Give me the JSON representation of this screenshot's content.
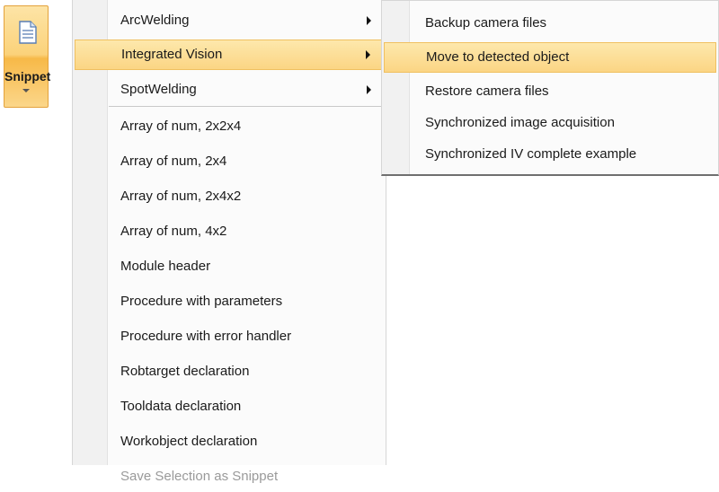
{
  "ribbon": {
    "snippet_label": "Snippet",
    "snippet_icon": "document-icon"
  },
  "menu": {
    "items": [
      {
        "label": "ArcWelding",
        "has_submenu": true
      },
      {
        "label": "Integrated Vision",
        "has_submenu": true,
        "highlighted": true
      },
      {
        "label": "SpotWelding",
        "has_submenu": true
      },
      {
        "label": "Array of num, 2x2x4"
      },
      {
        "label": "Array of num, 2x4"
      },
      {
        "label": "Array of num, 2x4x2"
      },
      {
        "label": "Array of num, 4x2"
      },
      {
        "label": "Module header"
      },
      {
        "label": "Procedure with parameters"
      },
      {
        "label": "Procedure with error handler"
      },
      {
        "label": "Robtarget declaration"
      },
      {
        "label": "Tooldata declaration"
      },
      {
        "label": "Workobject declaration"
      },
      {
        "label": "Save Selection as Snippet",
        "disabled": true
      }
    ]
  },
  "submenu": {
    "items": [
      {
        "label": "Backup camera files"
      },
      {
        "label": "Move to detected object",
        "highlighted": true
      },
      {
        "label": "Restore camera files"
      },
      {
        "label": "Synchronized image acquisition"
      },
      {
        "label": "Synchronized IV complete example"
      }
    ]
  },
  "colors": {
    "highlight": "#fbd584",
    "button_accent": "#f7b948",
    "disabled_text": "#9a9a9a"
  }
}
